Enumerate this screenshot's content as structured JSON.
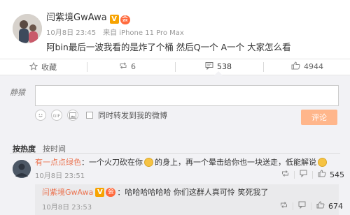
{
  "post": {
    "author": "闫紫境GwAwa",
    "vip_badge": "V",
    "member_badge": "会",
    "date": "10月8日 23:45",
    "source": "来自 iPhone 11 Pro Max",
    "text": "阿bin最后一波我看的是炸了个桶 然后Q一个 A一个 大家怎么看"
  },
  "actions": {
    "favorite_label": "收藏",
    "repost_count": "6",
    "comment_count": "538",
    "like_count": "4944"
  },
  "composer": {
    "my_avatar_text": "静猿",
    "input_value": "",
    "also_repost_label": "同时转发到我的微博",
    "submit_label": "评论"
  },
  "sort": {
    "hot_label": "按热度",
    "time_label": "按时间"
  },
  "comments": [
    {
      "nick": "有一点点绿色",
      "text": "：一个火刀砍在你",
      "text2": "的身上，再一个晕击给你也一块送走，低能解说",
      "date": "10月8日 23:51",
      "like_count": "545"
    }
  ],
  "reply": {
    "nick": "闫紫境GwAwa",
    "vip_badge": "V",
    "member_badge": "会",
    "text": "：哈哈哈哈哈哈 你们这群人真可怜 笑死我了",
    "date": "10月8日 23:53",
    "like_count": "674"
  },
  "colors": {
    "nick": "#eb7350",
    "submit_bg": "#ffb68b",
    "composer_bg": "#f2f2f5"
  }
}
